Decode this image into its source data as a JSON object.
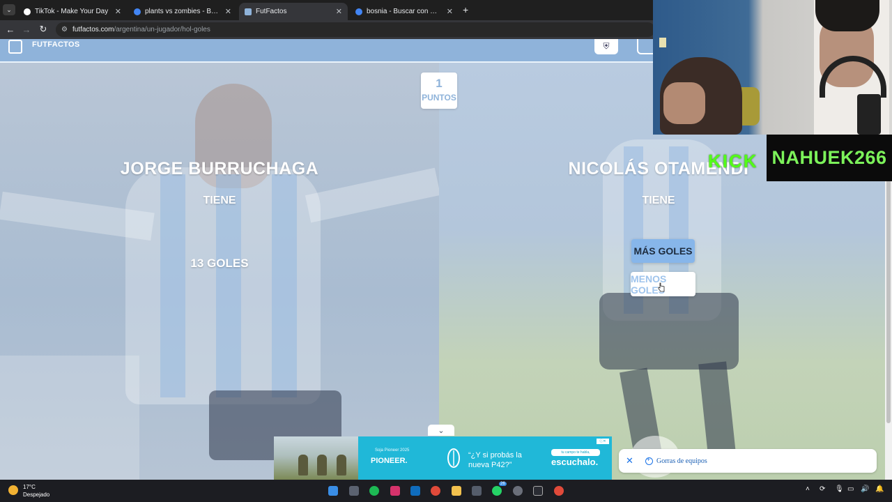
{
  "browser": {
    "tabs": [
      {
        "title": "TikTok - Make Your Day",
        "favicon_color": "#ffffff"
      },
      {
        "title": "plants vs zombies - Buscar con",
        "favicon_color": "#4285f4"
      },
      {
        "title": "FutFactos",
        "favicon_color": "#8fb3da"
      },
      {
        "title": "bosnia - Buscar con Google",
        "favicon_color": "#4285f4"
      }
    ],
    "active_tab": 2,
    "url_host": "futfactos.com",
    "url_path": "/argentina/un-jugador/hol-goles",
    "close_glyph": "✕",
    "new_tab_glyph": "+"
  },
  "site": {
    "name": "FUTFACTOS",
    "accent": "#8fb3da"
  },
  "game": {
    "score_value": "1",
    "score_label": "PUNTOS",
    "left_player": {
      "name": "JORGE BURRUCHAGA",
      "verb": "TIENE",
      "stat": "13 GOLES"
    },
    "right_player": {
      "name": "NICOLÁS OTAMENDI",
      "verb": "TIENE"
    },
    "buttons": {
      "more": "MÁS GOLES",
      "less": "MENOS GOLES"
    }
  },
  "ads": {
    "banner_small": "Soja Pioneer 2025",
    "banner_brand": "PIONEER.",
    "banner_question_line1": "“¿Y si probás la",
    "banner_question_line2": "nueva P42?”",
    "banner_cta_small": "tu campo te habla,",
    "banner_cta": "escuchalo.",
    "side_ad_text": "Gorras de equipos"
  },
  "stream": {
    "platform_label": "KICK",
    "channel_name": "NAHUEK266"
  },
  "taskbar": {
    "temperature": "17°C",
    "weather": "Despejado",
    "whatsapp_badge": "26"
  }
}
